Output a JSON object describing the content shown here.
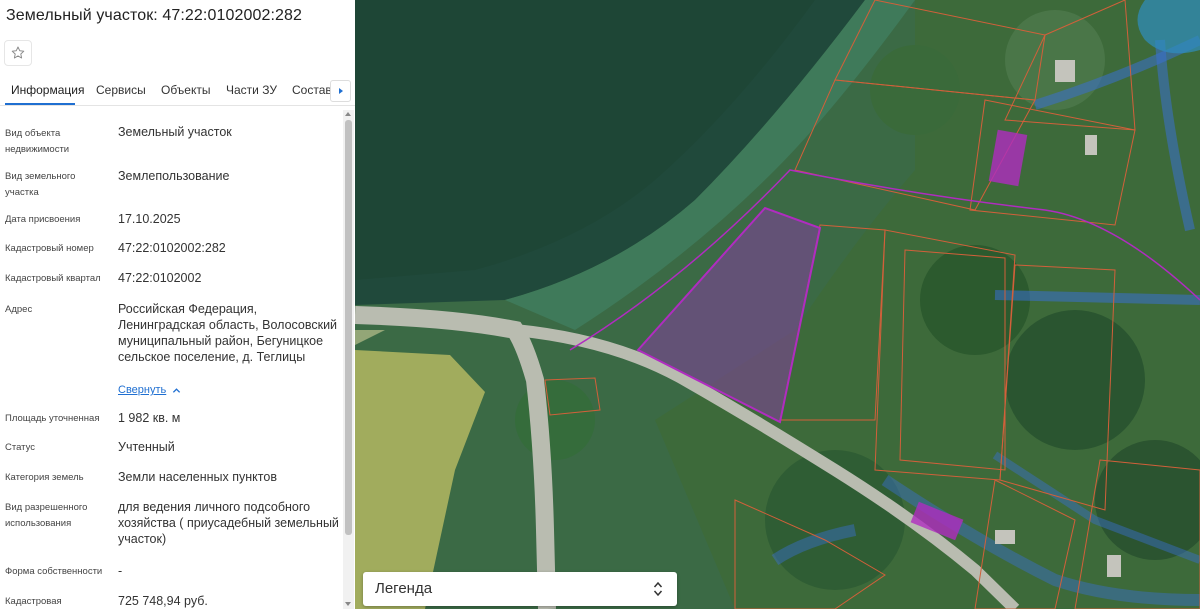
{
  "panel": {
    "title": "Земельный участок: 47:22:0102002:282",
    "tabs": [
      {
        "label": "Информация"
      },
      {
        "label": "Сервисы"
      },
      {
        "label": "Объекты"
      },
      {
        "label": "Части ЗУ"
      },
      {
        "label": "Состав"
      }
    ],
    "fields": [
      {
        "label": "Вид объекта недвижимости",
        "value": "Земельный участок"
      },
      {
        "label": "Вид земельного участка",
        "value": "Землепользование"
      },
      {
        "label": "Дата присвоения",
        "value": "17.10.2025"
      },
      {
        "label": "Кадастровый номер",
        "value": "47:22:0102002:282"
      },
      {
        "label": "Кадастровый квартал",
        "value": "47:22:0102002"
      },
      {
        "label": "Адрес",
        "value": "Российская Федерация, Ленинградская область, Волосовский муниципальный район, Бегуницкое сельское поселение, д. Теглицы"
      },
      {
        "label": "Площадь уточненная",
        "value": "1 982 кв. м"
      },
      {
        "label": "Статус",
        "value": "Учтенный"
      },
      {
        "label": "Категория земель",
        "value": "Земли населенных пунктов"
      },
      {
        "label": "Вид разрешенного использования",
        "value": "для ведения личного подсобного хозяйства ( приусадебный земельный участок)"
      },
      {
        "label": "Форма собственности",
        "value": "-"
      },
      {
        "label": "Кадастровая",
        "value": "725 748,94 руб."
      }
    ],
    "collapse_label": "Свернуть"
  },
  "map": {
    "legend_label": "Легенда",
    "colors": {
      "selected_parcel": "#b02cc0",
      "parcel_border": "#d2603a",
      "zone_line": "#3a6fd0",
      "yellow_zone": "#d9cf6a"
    }
  }
}
